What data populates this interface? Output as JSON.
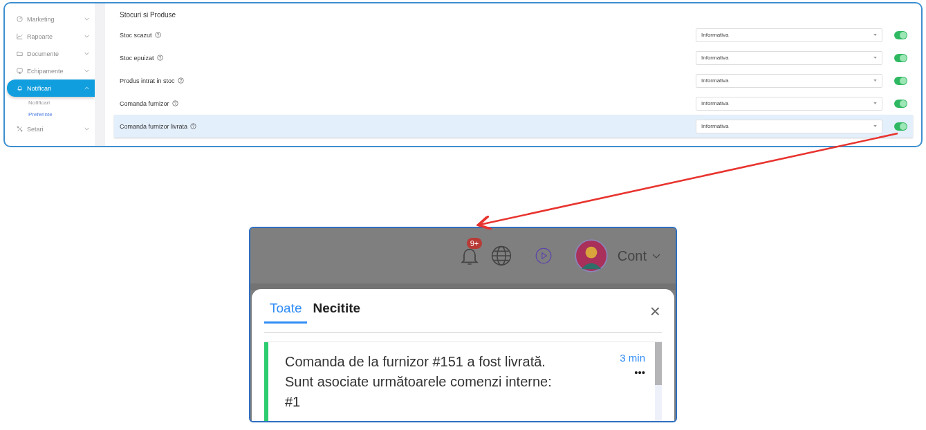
{
  "settings_panel": {
    "sidebar": {
      "items": [
        {
          "label": "Marketing",
          "expanded": false,
          "selected": false
        },
        {
          "label": "Rapoarte",
          "expanded": false,
          "selected": false
        },
        {
          "label": "Documente",
          "expanded": false,
          "selected": false
        },
        {
          "label": "Echipamente",
          "expanded": false,
          "selected": false
        },
        {
          "label": "Notificari",
          "expanded": true,
          "selected": true,
          "children": [
            {
              "label": "Notificari",
              "selected": false
            },
            {
              "label": "Preferinte",
              "selected": true
            }
          ]
        },
        {
          "label": "Setari",
          "expanded": false,
          "selected": false
        }
      ]
    },
    "section_title": "Stocuri si Produse",
    "rows": [
      {
        "label": "Stoc scazut",
        "level_select": "Informativa",
        "on": true,
        "selected": false
      },
      {
        "label": "Stoc epuizat",
        "level_select": "Informativa",
        "on": true,
        "selected": false
      },
      {
        "label": "Produs intrat in stoc",
        "level_select": "Informativa",
        "on": true,
        "selected": false
      },
      {
        "label": "Comanda furnizor",
        "level_select": "Informativa",
        "on": true,
        "selected": false
      },
      {
        "label": "Comanda furnizor livrata",
        "level_select": "Informativa",
        "on": true,
        "selected": true
      }
    ]
  },
  "notifications_panel": {
    "header": {
      "badge": "9+",
      "account": "Cont"
    },
    "tabs": [
      {
        "label": "Toate",
        "selected": true
      },
      {
        "label": "Necitite",
        "selected": false
      }
    ],
    "close": "×",
    "items": [
      {
        "message": "Comanda de la furnizor #151 a fost livrată. Sunt asociate următoarele comenzi interne: #1",
        "time": "3 min",
        "more": "•••",
        "unread": true
      }
    ]
  }
}
